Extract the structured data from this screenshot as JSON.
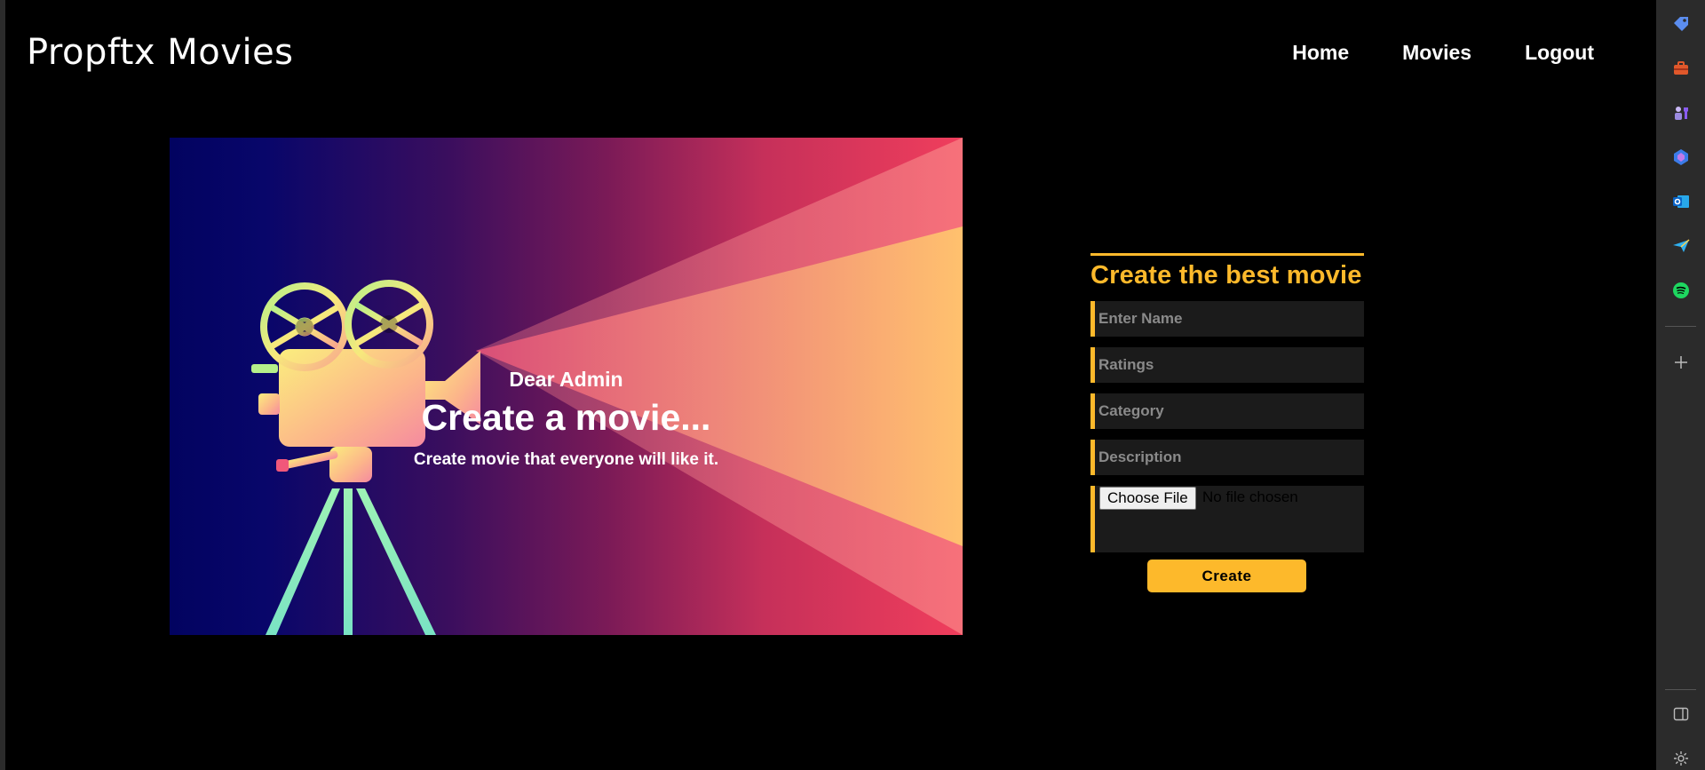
{
  "header": {
    "brand": "Propftx Movies",
    "nav": [
      {
        "label": "Home"
      },
      {
        "label": "Movies"
      },
      {
        "label": "Logout"
      }
    ]
  },
  "hero": {
    "greeting": "Dear Admin",
    "title": "Create a movie...",
    "subtitle": "Create movie that everyone will like it."
  },
  "form": {
    "title": "Create the best movie",
    "name_placeholder": "Enter Name",
    "ratings_placeholder": "Ratings",
    "category_placeholder": "Category",
    "description_placeholder": "Description",
    "file_button": "Choose File",
    "file_status": "No file chosen",
    "submit_label": "Create"
  },
  "sidebar": {
    "icons": [
      "tag-icon",
      "toolbox-icon",
      "chess-icon",
      "copilot-icon",
      "outlook-icon",
      "send-icon",
      "spotify-icon",
      "add-icon",
      "panel-icon",
      "settings-icon"
    ]
  },
  "colors": {
    "accent": "#fdb92b",
    "background": "#000000",
    "field_bg": "#1b1b1b"
  }
}
